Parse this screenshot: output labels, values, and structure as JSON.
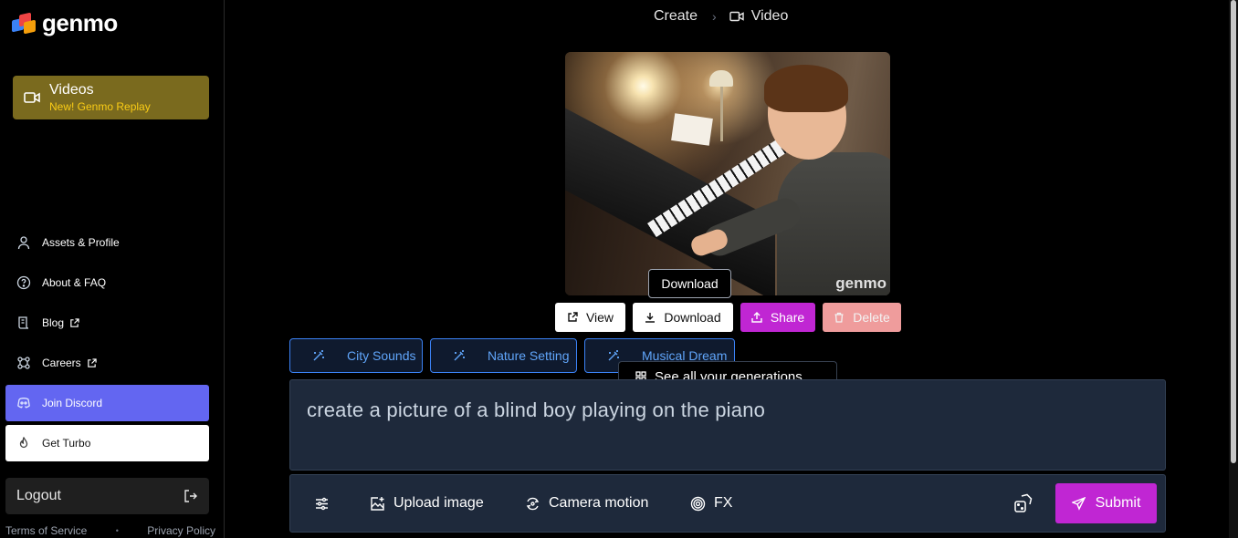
{
  "brand": {
    "name": "genmo"
  },
  "sidebar": {
    "videos_card": {
      "title": "Videos",
      "subtitle": "New! Genmo Replay"
    },
    "items": [
      {
        "label": "Assets & Profile",
        "icon": "user-icon"
      },
      {
        "label": "About & FAQ",
        "icon": "question-circle-icon"
      },
      {
        "label": "Blog",
        "icon": "scroll-icon",
        "external": true
      },
      {
        "label": "Careers",
        "icon": "careers-icon",
        "external": true
      },
      {
        "label": "Join Discord",
        "icon": "discord-icon"
      },
      {
        "label": "Get Turbo",
        "icon": "flame-icon"
      }
    ],
    "logout_label": "Logout",
    "legal": {
      "terms": "Terms of Service",
      "separator": "•",
      "privacy": "Privacy Policy"
    }
  },
  "breadcrumb": {
    "root": "Create",
    "separator": "›",
    "current": "Video"
  },
  "preview": {
    "watermark": "genmo",
    "tooltip": "Download"
  },
  "actions": {
    "view": "View",
    "download": "Download",
    "share": "Share",
    "delete": "Delete"
  },
  "suggestions": [
    "City Sounds",
    "Nature Setting",
    "Musical Dream"
  ],
  "see_all_label": "See all your generations",
  "prompt": {
    "text": "create a picture of a blind boy playing on the piano"
  },
  "toolbar": {
    "upload": "Upload image",
    "camera": "Camera motion",
    "fx": "FX",
    "submit": "Submit"
  },
  "colors": {
    "accent": "#c026d3",
    "discord": "#6366f1",
    "videos_card": "#7a6a1e",
    "videos_sub": "#facc15",
    "chip_border": "#3b82f6",
    "panel": "#1e293b",
    "delete": "#fca5a5"
  }
}
